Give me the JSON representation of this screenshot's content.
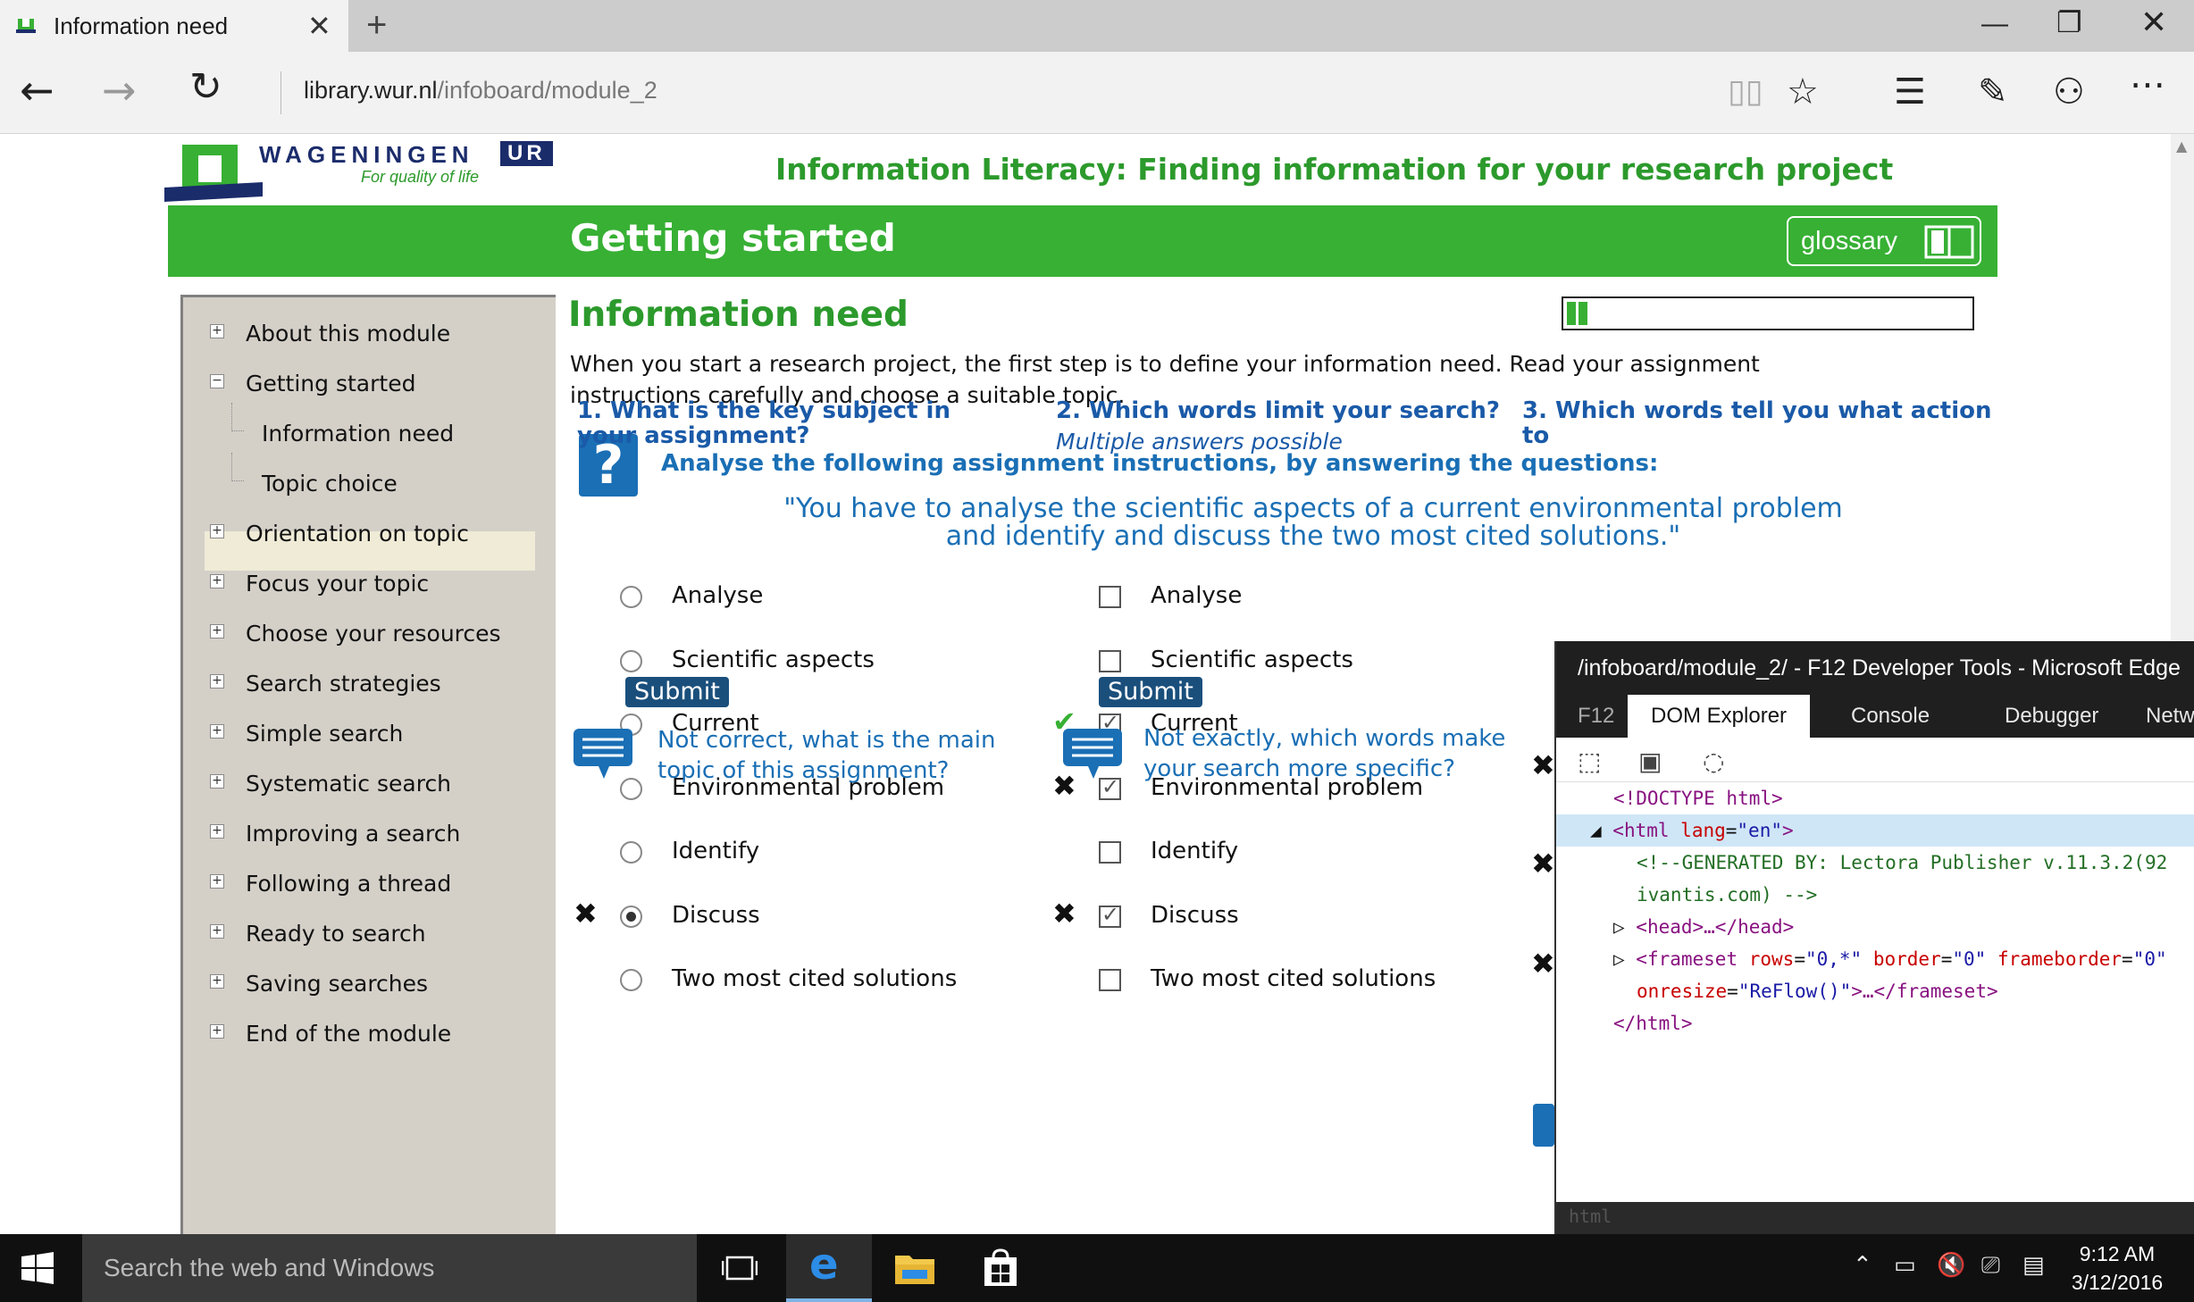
{
  "browser": {
    "tab_title": "Information need",
    "url_host": "library.wur.nl",
    "url_path": "/infoboard/module_2"
  },
  "header": {
    "logo_word": "WAGENINGEN",
    "logo_ur": "UR",
    "logo_tagline": "For quality of life",
    "course_title": "Information Literacy: Finding information for your research project",
    "section_title": "Getting started",
    "glossary_label": "glossary"
  },
  "sidebar": {
    "items": [
      {
        "label": "About this module",
        "expander": "+"
      },
      {
        "label": "Getting started",
        "expander": "−"
      },
      {
        "label": "Information need",
        "child": true,
        "selected": true
      },
      {
        "label": "Topic choice",
        "child": true
      },
      {
        "label": "Orientation on topic",
        "expander": "+"
      },
      {
        "label": "Focus your topic",
        "expander": "+"
      },
      {
        "label": "Choose your resources",
        "expander": "+"
      },
      {
        "label": "Search strategies",
        "expander": "+"
      },
      {
        "label": "Simple search",
        "expander": "+"
      },
      {
        "label": "Systematic search",
        "expander": "+"
      },
      {
        "label": "Improving a search",
        "expander": "+"
      },
      {
        "label": "Following a thread",
        "expander": "+"
      },
      {
        "label": "Ready to search",
        "expander": "+"
      },
      {
        "label": "Saving searches",
        "expander": "+"
      },
      {
        "label": "End of the module",
        "expander": "+"
      }
    ]
  },
  "content": {
    "title": "Information need",
    "progress_fraction": 0.05,
    "intro_line1": "When you start a research project, the first step is to define your information need. Read your assignment",
    "intro_line2": "instructions carefully and choose a suitable topic.",
    "question_icon": "?",
    "instruction_heading": "Analyse the following assignment instructions, by answering the questions:",
    "quote_line1": "\"You have to analyse the scientific aspects of a current environmental problem",
    "quote_line2": "and identify and discuss the two most cited solutions.\""
  },
  "q1": {
    "heading_line1": "1. What is the key subject in",
    "heading_line2": "your assignment?",
    "options": [
      "Analyse",
      "Scientific aspects",
      "Current",
      "Environmental problem",
      "Identify",
      "Discuss",
      "Two most cited solutions"
    ],
    "selected_index": 5,
    "wrong_mark_index": 5,
    "submit_label": "Submit",
    "feedback_line1": "Not correct, what is the main",
    "feedback_line2": "topic of this assignment?"
  },
  "q2": {
    "heading": "2. Which words limit your search?",
    "subheading": "Multiple answers possible",
    "options": [
      "Analyse",
      "Scientific aspects",
      "Current",
      "Environmental problem",
      "Identify",
      "Discuss",
      "Two most cited solutions"
    ],
    "checked": [
      false,
      false,
      true,
      true,
      false,
      true,
      false
    ],
    "marks": [
      "",
      "",
      "ok",
      "x",
      "",
      "x",
      ""
    ],
    "submit_label": "Submit",
    "feedback_line1": "Not exactly, which words make",
    "feedback_line2": "your search more specific?"
  },
  "q3": {
    "heading_line1": "3. Which words tell you what action",
    "heading_line2": "to"
  },
  "devtools": {
    "title": "/infoboard/module_2/ - F12 Developer Tools - Microsoft Edge",
    "tabs": [
      "F12",
      "DOM Explorer",
      "Console",
      "Debugger",
      "Netw"
    ],
    "active_tab": "DOM Explorer",
    "dom_lines": {
      "doctype": "<!DOCTYPE html>",
      "html_open_tag": "<html",
      "html_attr": "lang",
      "html_val": "\"en\"",
      "comment_1": "<!--GENERATED BY: Lectora Publisher v.11.3.2(92",
      "comment_2": "ivantis.com) -->",
      "head": "<head>…</head>",
      "frameset_tag": "<frameset",
      "frameset_rows_attr": "rows",
      "frameset_rows_val": "\"0,*\"",
      "frameset_border_attr": "border",
      "frameset_border_val": "\"0\"",
      "frameset_fb_attr": "frameborder",
      "frameset_fb_val": "\"0\"",
      "onresize_attr": "onresize",
      "onresize_val": "\"ReFlow()\"",
      "frameset_close": ">…</frameset>",
      "html_close": "</html>"
    },
    "breadcrumb": "html"
  },
  "taskbar": {
    "search_placeholder": "Search the web and Windows",
    "time": "9:12 AM",
    "date": "3/12/2016"
  },
  "colors": {
    "brand_green": "#37b034",
    "link_blue": "#1a6fb5",
    "submit_bg": "#1a4f7c"
  }
}
